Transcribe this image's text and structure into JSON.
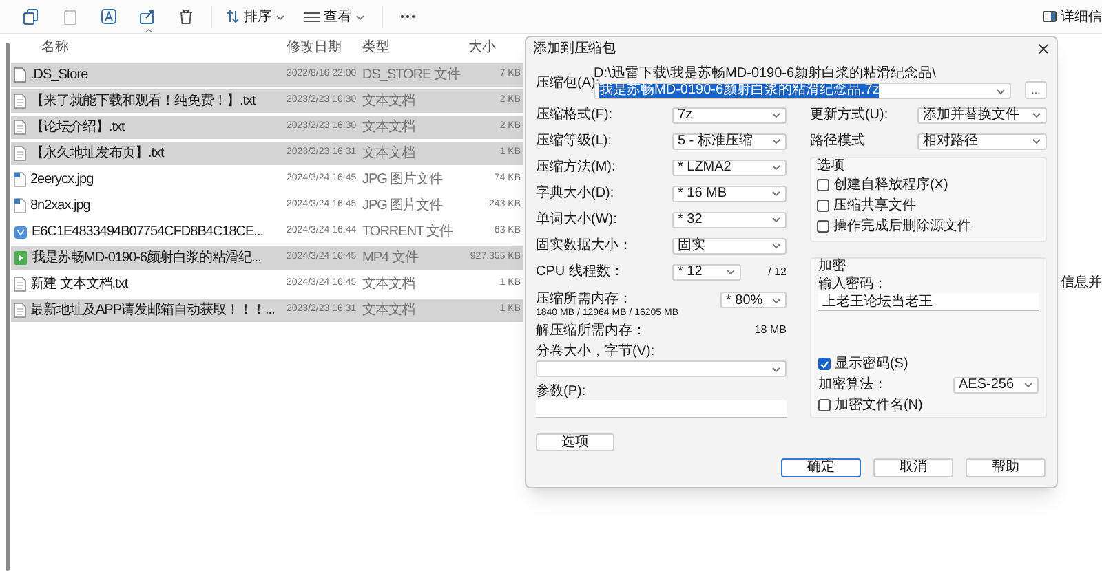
{
  "toolbar": {
    "sort": "排序",
    "view": "查看",
    "details": "详细信"
  },
  "columns": [
    "名称",
    "修改日期",
    "类型",
    "大小"
  ],
  "files": [
    {
      "name": ".DS_Store",
      "date": "2022/8/16 22:00",
      "type": "DS_STORE 文件",
      "size": "7 KB",
      "kind": "blank",
      "selected": true
    },
    {
      "name": "【来了就能下载和观看！纯免费！】.txt",
      "date": "2023/2/23 16:30",
      "type": "文本文档",
      "size": "2 KB",
      "kind": "text",
      "selected": true
    },
    {
      "name": "【论坛介绍】.txt",
      "date": "2023/2/23 16:30",
      "type": "文本文档",
      "size": "2 KB",
      "kind": "text",
      "selected": true
    },
    {
      "name": "【永久地址发布页】.txt",
      "date": "2023/2/23 16:31",
      "type": "文本文档",
      "size": "1 KB",
      "kind": "text",
      "selected": true
    },
    {
      "name": "2eerycx.jpg",
      "date": "2024/3/24 16:45",
      "type": "JPG 图片文件",
      "size": "74 KB",
      "kind": "image",
      "selected": false
    },
    {
      "name": "8n2xax.jpg",
      "date": "2024/3/24 16:45",
      "type": "JPG 图片文件",
      "size": "243 KB",
      "kind": "image",
      "selected": false
    },
    {
      "name": "E6C1E4833494B07754CFD8B4C18CE...",
      "date": "2024/3/24 16:44",
      "type": "TORRENT 文件",
      "size": "63 KB",
      "kind": "torrent",
      "selected": false
    },
    {
      "name": "我是苏畅MD-0190-6颜射白浆的粘滑纪...",
      "date": "2024/3/24 16:45",
      "type": "MP4 文件",
      "size": "927,355 KB",
      "kind": "video",
      "selected": true
    },
    {
      "name": "新建 文本文档.txt",
      "date": "2024/3/24 16:45",
      "type": "文本文档",
      "size": "1 KB",
      "kind": "text",
      "selected": false
    },
    {
      "name": "最新地址及APP请发邮箱自动获取！！！...",
      "date": "2023/2/23 16:31",
      "type": "文本文档",
      "size": "1 KB",
      "kind": "text",
      "selected": true
    }
  ],
  "background_text": "信息并",
  "dialog": {
    "title": "添加到压缩包",
    "archive": {
      "label": "压缩包(A):",
      "path": "D:\\迅雷下载\\我是苏畅MD-0190-6颜射白浆的粘滑纪念品\\",
      "name": "我是苏畅MD-0190-6颜射白浆的粘滑纪念品.7z",
      "browse": "..."
    },
    "left_options": [
      {
        "label": "压缩格式(F):",
        "value": "7z"
      },
      {
        "label": "压缩等级(L):",
        "value": "5 - 标准压缩"
      },
      {
        "label": "压缩方法(M):",
        "value": "* LZMA2"
      },
      {
        "label": "字典大小(D):",
        "value": "* 16 MB"
      },
      {
        "label": "单词大小(W):",
        "value": "* 32"
      },
      {
        "label": "固实数据大小：",
        "value": "固实"
      }
    ],
    "cpu_threads": {
      "label": "CPU 线程数：",
      "value": "* 12",
      "max": "/ 12"
    },
    "memory": {
      "label": "压缩所需内存：",
      "detail": "1840 MB / 12964 MB / 16205 MB",
      "value": "* 80%"
    },
    "decompress_memory": {
      "label": "解压缩所需内存：",
      "value": "18 MB"
    },
    "volume_size": {
      "label": "分卷大小，字节(V):"
    },
    "parameters": {
      "label": "参数(P):"
    },
    "options_button": "选项",
    "update_mode": {
      "label": "更新方式(U):",
      "value": "添加并替换文件"
    },
    "path_mode": {
      "label": "路径模式",
      "value": "相对路径"
    },
    "options_group": {
      "title": "选项",
      "checkboxes": [
        {
          "label": "创建自释放程序(X)",
          "checked": false
        },
        {
          "label": "压缩共享文件",
          "checked": false
        },
        {
          "label": "操作完成后删除源文件",
          "checked": false
        }
      ]
    },
    "encryption": {
      "title": "加密",
      "password_label": "输入密码：",
      "password": "上老王论坛当老王",
      "show_password": {
        "label": "显示密码(S)",
        "checked": true
      },
      "method_label": "加密算法：",
      "method": "AES-256",
      "encrypt_names": {
        "label": "加密文件名(N)",
        "checked": false
      }
    },
    "buttons": [
      {
        "label": "确定",
        "default": true
      },
      {
        "label": "取消",
        "default": false
      },
      {
        "label": "帮助",
        "default": false
      }
    ]
  }
}
